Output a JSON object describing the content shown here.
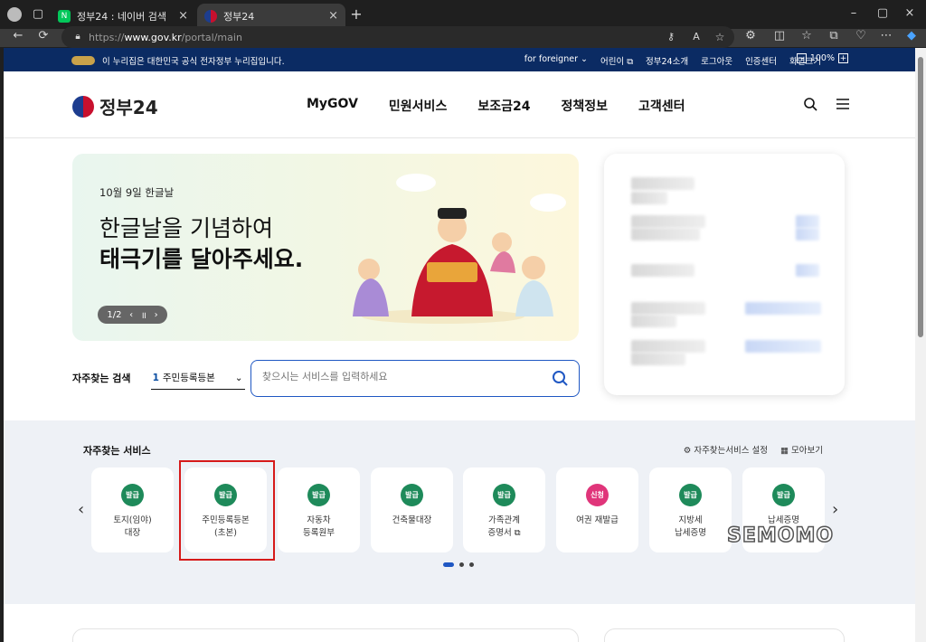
{
  "browser": {
    "tabs": [
      {
        "title": "정부24 : 네이버 검색",
        "favicon_color": "#03c75a",
        "favicon_letter": "N"
      },
      {
        "title": "정부24",
        "favicon_color": "#ffffff"
      }
    ],
    "url_prefix": "https://",
    "url_host": "www.gov.kr",
    "url_path": "/portal/main",
    "window_buttons": [
      "minimize",
      "maximize",
      "close"
    ]
  },
  "notice": {
    "logo": "eG",
    "text": "이 누리집은 대한민국 공식 전자정부 누리집입니다.",
    "links": [
      "for foreigner",
      "어린이",
      "정부24소개",
      "로그아웃",
      "인증센터"
    ],
    "zoom_label": "화면크기",
    "zoom_value": "100%"
  },
  "header": {
    "logo_text": "정부24",
    "nav": [
      "MyGOV",
      "민원서비스",
      "보조금24",
      "정책정보",
      "고객센터"
    ]
  },
  "banner": {
    "subtitle": "10월 9일 한글날",
    "title_line1": "한글날을 기념하여",
    "title_line2": "태극기를 달아주세요.",
    "pager": "1/2"
  },
  "frequent_search": {
    "label": "자주찾는 검색",
    "selected_number": "1",
    "selected_text": "주민등록등본",
    "placeholder": "찾으시는 서비스를 입력하세요"
  },
  "services": {
    "title": "자주찾는 서비스",
    "settings_label": "자주찾는서비스 설정",
    "view_all_label": "모아보기",
    "items": [
      {
        "badge": "발급",
        "name": "토지(임야)\n대장",
        "pink": false
      },
      {
        "badge": "발급",
        "name": "주민등록등본\n(초본)",
        "pink": false
      },
      {
        "badge": "발급",
        "name": "자동차\n등록원부",
        "pink": false
      },
      {
        "badge": "발급",
        "name": "건축물대장",
        "pink": false
      },
      {
        "badge": "발급",
        "name": "가족관계\n증명서",
        "pink": false
      },
      {
        "badge": "신청",
        "name": "여권 재발급",
        "pink": true
      },
      {
        "badge": "발급",
        "name": "지방세\n납세증명",
        "pink": false
      },
      {
        "badge": "발급",
        "name": "납세증명",
        "pink": false
      }
    ]
  },
  "watermark": "SEMOMO",
  "colors": {
    "navy": "#0b2b63",
    "accent": "#1f57c3",
    "green": "#1e8a5a",
    "pink": "#e0357a",
    "highlight": "#d61a1a"
  }
}
